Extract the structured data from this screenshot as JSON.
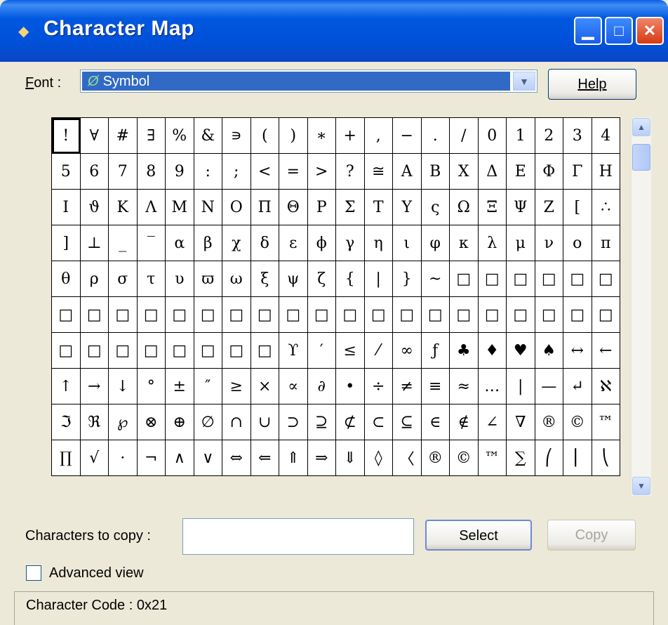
{
  "window": {
    "title": "Character Map",
    "app_icon": "character-map-icon",
    "controls": [
      "minimize-icon",
      "maximize-icon",
      "close-icon"
    ]
  },
  "font_row": {
    "label": "Font :",
    "selected_font": "Symbol",
    "font_icon": "opentype-font-icon"
  },
  "help_button": "Help",
  "character_grid": {
    "selected_index": 0,
    "rows": [
      [
        "!",
        "∀",
        "#",
        "∃",
        "%",
        "&",
        "∍",
        "(",
        ")",
        "∗",
        "+",
        ",",
        "−",
        ".",
        "/",
        "0",
        "1",
        "2",
        "3",
        "4"
      ],
      [
        "5",
        "6",
        "7",
        "8",
        "9",
        ":",
        ";",
        "<",
        "=",
        ">",
        "?",
        "≅",
        "Α",
        "Β",
        "Χ",
        "Δ",
        "Ε",
        "Φ",
        "Γ",
        "Η"
      ],
      [
        "Ι",
        "ϑ",
        "Κ",
        "Λ",
        "Μ",
        "Ν",
        "Ο",
        "Π",
        "Θ",
        "Ρ",
        "Σ",
        "Τ",
        "Υ",
        "ς",
        "Ω",
        "Ξ",
        "Ψ",
        "Ζ",
        "[",
        "∴"
      ],
      [
        "]",
        "⊥",
        "_",
        "‾",
        "α",
        "β",
        "χ",
        "δ",
        "ε",
        "ϕ",
        "γ",
        "η",
        "ι",
        "φ",
        "κ",
        "λ",
        "μ",
        "ν",
        "ο",
        "π"
      ],
      [
        "θ",
        "ρ",
        "σ",
        "τ",
        "υ",
        "ϖ",
        "ω",
        "ξ",
        "ψ",
        "ζ",
        "{",
        "|",
        "}",
        "~",
        "□",
        "□",
        "□",
        "□",
        "□",
        "□"
      ],
      [
        "□",
        "□",
        "□",
        "□",
        "□",
        "□",
        "□",
        "□",
        "□",
        "□",
        "□",
        "□",
        "□",
        "□",
        "□",
        "□",
        "□",
        "□",
        "□",
        "□"
      ],
      [
        "□",
        "□",
        "□",
        "□",
        "□",
        "□",
        "□",
        "□",
        "ϒ",
        "′",
        "≤",
        "⁄",
        "∞",
        "ƒ",
        "♣",
        "♦",
        "♥",
        "♠",
        "↔",
        "←"
      ],
      [
        "↑",
        "→",
        "↓",
        "°",
        "±",
        "″",
        "≥",
        "×",
        "∝",
        "∂",
        "•",
        "÷",
        "≠",
        "≡",
        "≈",
        "…",
        "|",
        "—",
        "↵",
        "ℵ"
      ],
      [
        "ℑ",
        "ℜ",
        "℘",
        "⊗",
        "⊕",
        "∅",
        "∩",
        "∪",
        "⊃",
        "⊇",
        "⊄",
        "⊂",
        "⊆",
        "∈",
        "∉",
        "∠",
        "∇",
        "®",
        "©",
        "™"
      ],
      [
        "∏",
        "√",
        "⋅",
        "¬",
        "∧",
        "∨",
        "⇔",
        "⇐",
        "⇑",
        "⇒",
        "⇓",
        "◊",
        "〈",
        "®",
        "©",
        "™",
        "∑",
        "⎛",
        "⎜",
        "⎝"
      ]
    ]
  },
  "scrollbar": {
    "up": "scroll-up-arrow-icon",
    "down": "scroll-down-arrow-icon"
  },
  "copy_row": {
    "label": "Characters to copy :",
    "value": "",
    "select_button": "Select",
    "copy_button": "Copy"
  },
  "advanced_view": {
    "label": "Advanced view",
    "checked": false
  },
  "status": {
    "text": "Character Code : 0x21"
  }
}
